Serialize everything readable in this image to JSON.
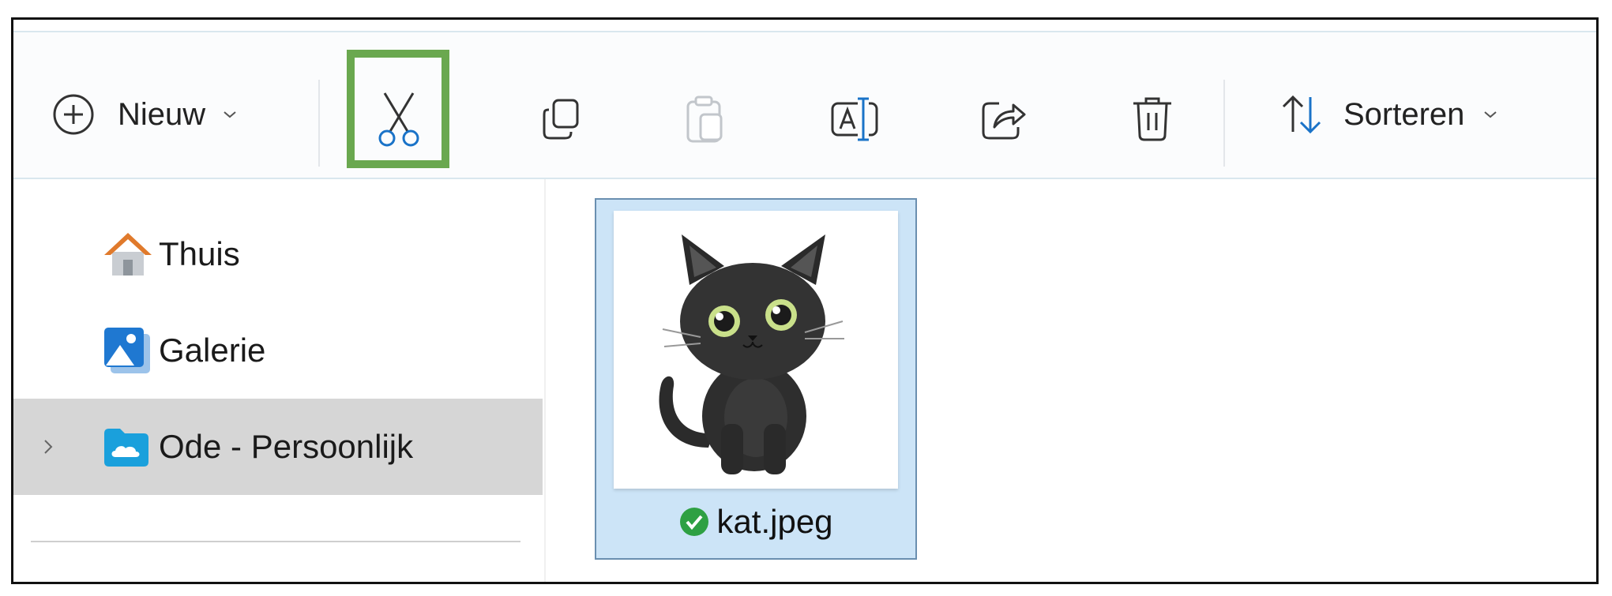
{
  "toolbar": {
    "new_label": "Nieuw",
    "sort_label": "Sorteren",
    "actions": [
      "cut",
      "copy",
      "paste",
      "rename",
      "share",
      "delete"
    ]
  },
  "sidebar": {
    "items": [
      {
        "label": "Thuis",
        "icon": "home-icon"
      },
      {
        "label": "Galerie",
        "icon": "gallery-icon"
      },
      {
        "label": "Ode - Persoonlijk",
        "icon": "onedrive-folder-icon",
        "selected": true
      }
    ]
  },
  "files": [
    {
      "name": "kat.jpeg",
      "status": "synced",
      "selected": true
    }
  ],
  "colors": {
    "highlight": "#6aa84f",
    "selection": "#cce4f7",
    "accent": "#1a73c8",
    "status_ok": "#2ea043"
  }
}
